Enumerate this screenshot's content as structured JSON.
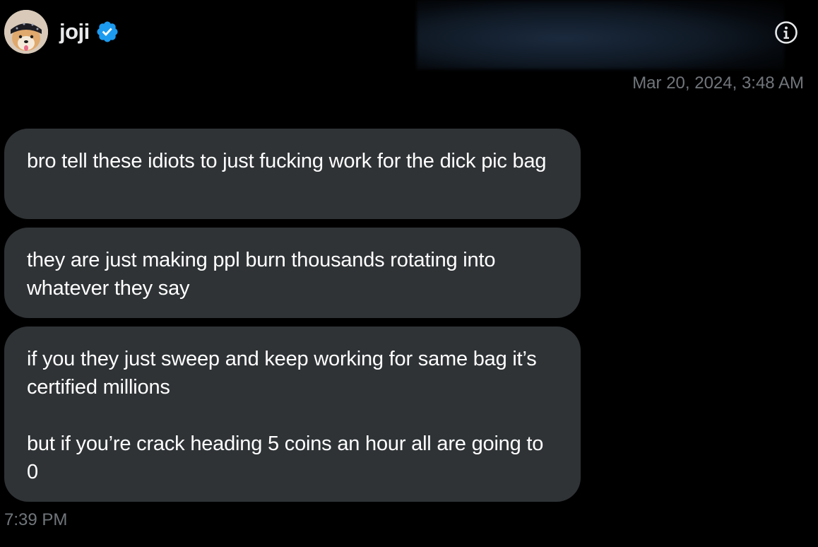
{
  "header": {
    "name": "joji",
    "verified_color": "#1d9bf0",
    "avatar_icon": "shiba-dog-avatar",
    "info_icon": "info-icon"
  },
  "conversation": {
    "date": "Mar 20, 2024, 3:48 AM",
    "messages": [
      {
        "paragraphs": [
          "bro tell these idiots to just fucking work for the dick pic bag"
        ]
      },
      {
        "paragraphs": [
          "they are just making ppl burn thousands rotating into whatever they say"
        ]
      },
      {
        "paragraphs": [
          "if you they just sweep and keep working for same bag it’s certified millions",
          "but if you’re crack heading 5 coins an hour all are going to 0"
        ]
      }
    ],
    "time": "7:39 PM"
  },
  "colors": {
    "background": "#000000",
    "bubble": "#2f3336",
    "muted_text": "#71767b",
    "text": "#ffffff"
  }
}
